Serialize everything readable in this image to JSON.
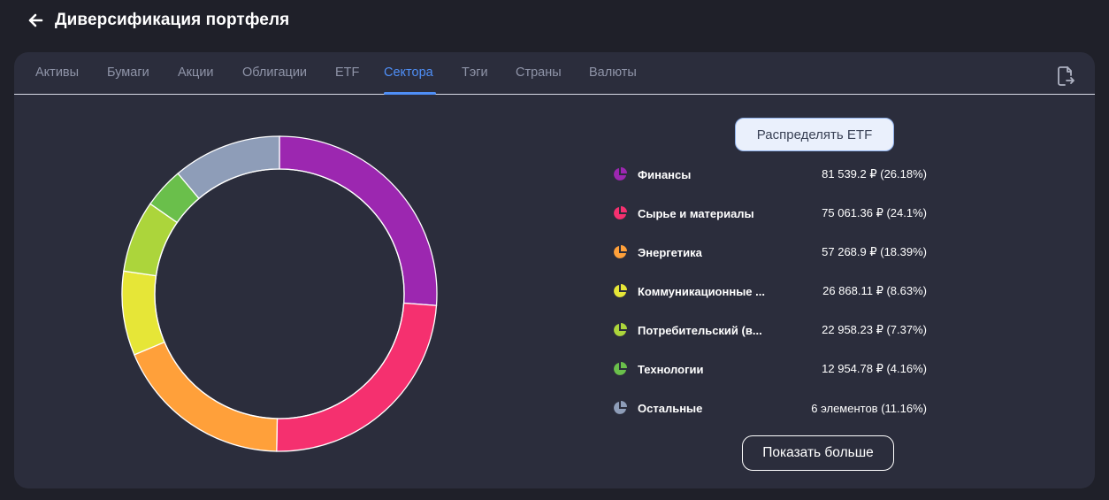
{
  "header": {
    "title": "Диверсификация портфеля",
    "back_icon": "arrow-left-icon"
  },
  "tabs": [
    {
      "label": "Активы",
      "active": false
    },
    {
      "label": "Бумаги",
      "active": false
    },
    {
      "label": "Акции",
      "active": false
    },
    {
      "label": "Облигации",
      "active": false
    },
    {
      "label": "ETF",
      "active": false
    },
    {
      "label": "Сектора",
      "active": true
    },
    {
      "label": "Тэги",
      "active": false
    },
    {
      "label": "Страны",
      "active": false
    },
    {
      "label": "Валюты",
      "active": false
    }
  ],
  "toolbar": {
    "export_icon": "file-export-icon"
  },
  "colors": {
    "accent": "#4f8ff7",
    "background": "#1f2029",
    "card": "#2b2d3c"
  },
  "actions": {
    "etf_label": "Распределять ETF",
    "more_label": "Показать больше"
  },
  "legend": [
    {
      "name": "Финансы",
      "value": "81 539.2 ₽ (26.18%)",
      "color": "#9c27b0"
    },
    {
      "name": "Сырье и материалы",
      "value": "75 061.36 ₽ (24.1%)",
      "color": "#f5306f"
    },
    {
      "name": "Энергетика",
      "value": "57 268.9 ₽ (18.39%)",
      "color": "#ffa03a"
    },
    {
      "name": "Коммуникационные ...",
      "value": "26 868.11 ₽ (8.63%)",
      "color": "#e6e637"
    },
    {
      "name": "Потребительский (в...",
      "value": "22 958.23 ₽ (7.37%)",
      "color": "#acd53b"
    },
    {
      "name": "Технологии",
      "value": "12 954.78 ₽ (4.16%)",
      "color": "#6abf4b"
    },
    {
      "name": "Остальные",
      "value": "6 элементов (11.16%)",
      "color": "#8e9db8"
    }
  ],
  "chart_data": {
    "type": "pie",
    "categories": [
      "Финансы",
      "Сырье и материалы",
      "Энергетика",
      "Коммуникационные ...",
      "Потребительский (в...",
      "Технологии",
      "Остальные"
    ],
    "values": [
      26.18,
      24.1,
      18.39,
      8.63,
      7.37,
      4.16,
      11.16
    ],
    "colors": [
      "#9c27b0",
      "#f5306f",
      "#ffa03a",
      "#e6e637",
      "#acd53b",
      "#6abf4b",
      "#8e9db8"
    ],
    "donut": true
  }
}
